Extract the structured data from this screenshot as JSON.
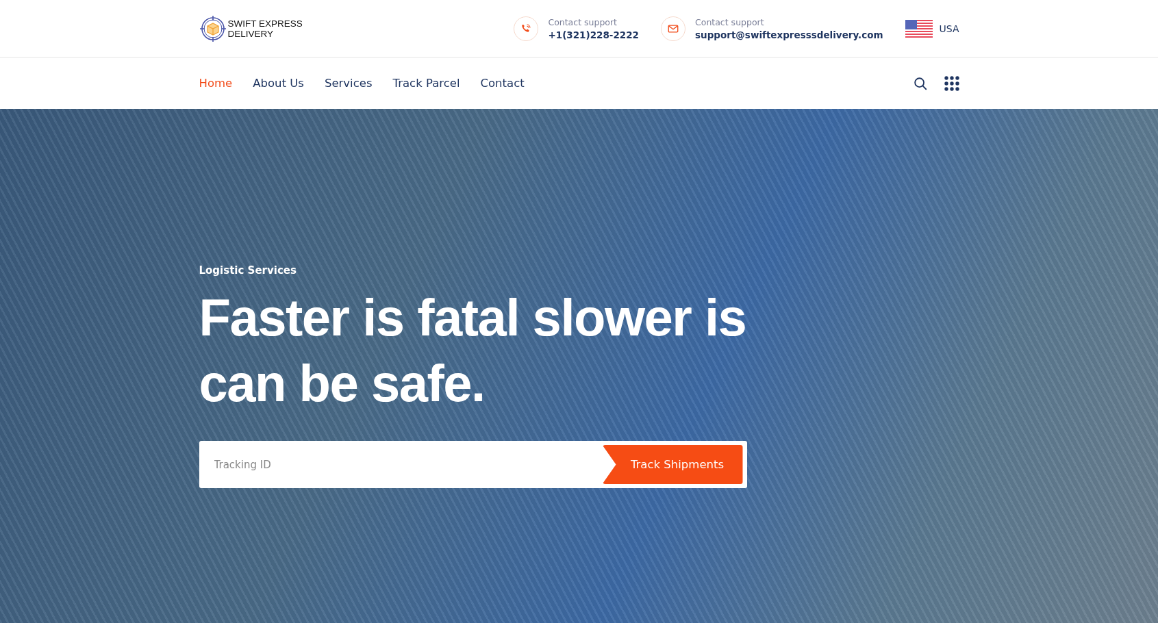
{
  "logo": {
    "line1": "SWIFT EXPRESS",
    "line2": "DELIVERY"
  },
  "contacts": [
    {
      "kind": "phone",
      "label": "Contact support",
      "value": "+1(321)228-2222"
    },
    {
      "kind": "email",
      "label": "Contact support",
      "value": "support@swiftexpresssdelivery.com"
    }
  ],
  "language": {
    "label": "USA"
  },
  "nav": [
    {
      "label": "Home",
      "selected": true
    },
    {
      "label": "About Us",
      "selected": false
    },
    {
      "label": "Services",
      "selected": false
    },
    {
      "label": "Track Parcel",
      "selected": false
    },
    {
      "label": "Contact",
      "selected": false
    }
  ],
  "hero": {
    "eyebrow": "Logistic Services",
    "headline": "Faster is fatal slower is can be safe.",
    "tracking": {
      "placeholder": "Tracking ID",
      "button": "Track Shipments"
    }
  }
}
